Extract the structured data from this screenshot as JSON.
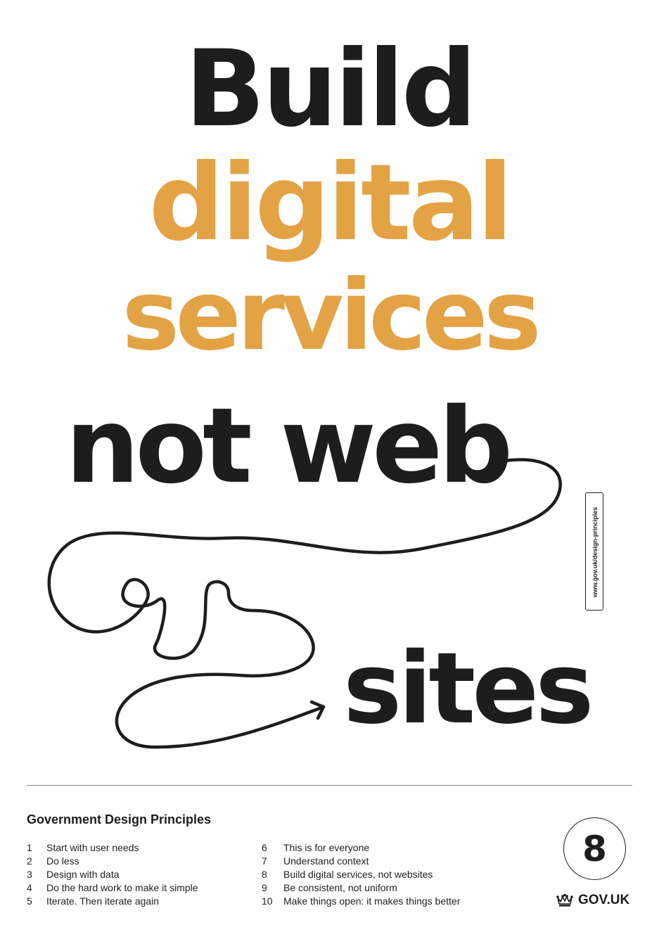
{
  "headline": {
    "line1": "Build",
    "line2": "digital",
    "line3": "services",
    "line4": "not web",
    "line5": "sites"
  },
  "colors": {
    "accent": "#e3a244",
    "text": "#1d1d1b",
    "rule": "#8a8a8a"
  },
  "url_tag": "www.gov.uk/design-principles",
  "footer": {
    "title": "Government Design Principles",
    "principles_left": [
      {
        "num": "1",
        "text": "Start with user needs"
      },
      {
        "num": "2",
        "text": "Do less"
      },
      {
        "num": "3",
        "text": "Design with data"
      },
      {
        "num": "4",
        "text": "Do the hard work to make it simple"
      },
      {
        "num": "5",
        "text": "Iterate. Then iterate again"
      }
    ],
    "principles_right": [
      {
        "num": "6",
        "text": "This is for everyone"
      },
      {
        "num": "7",
        "text": "Understand context"
      },
      {
        "num": "8",
        "text": "Build digital services, not websites"
      },
      {
        "num": "9",
        "text": "Be consistent, not uniform"
      },
      {
        "num": "10",
        "text": "Make things open: it makes things better"
      }
    ],
    "badge_number": "8",
    "brand": "GOV.UK",
    "brand_icon": "crown-icon"
  }
}
